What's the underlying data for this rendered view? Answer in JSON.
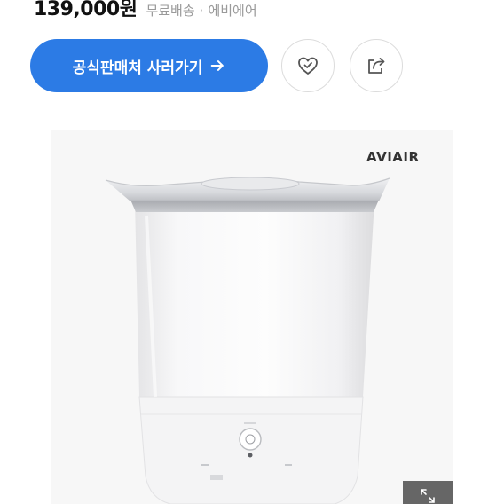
{
  "product": {
    "price": "139,000원",
    "shipping": "무료배송",
    "separator": "·",
    "seller": "에비에어",
    "brand_logo": "AVIAIR"
  },
  "actions": {
    "buy_label": "공식판매처 사러가기",
    "buy_arrow_icon": "arrow-right-icon",
    "like_icon": "heart-check-icon",
    "share_icon": "share-icon",
    "expand_icon": "expand-icon"
  },
  "colors": {
    "accent": "#2c7be5",
    "price_text": "#111111",
    "meta_text": "#9a9a9a"
  }
}
